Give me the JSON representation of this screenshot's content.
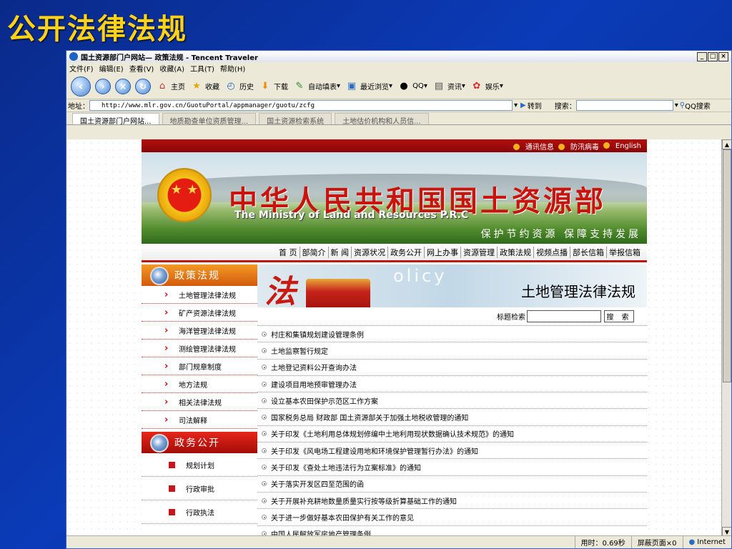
{
  "slide_title": "公开法律法规",
  "window": {
    "title": "国土资源部门户网站— 政策法规 - Tencent Traveler",
    "controls": [
      "_",
      "□",
      "×"
    ]
  },
  "menu": [
    "文件(F)",
    "编辑(E)",
    "查看(V)",
    "收藏(A)",
    "工具(T)",
    "帮助(H)"
  ],
  "toolbar": {
    "home": "主页",
    "favorites": "收藏",
    "history": "历史",
    "download": "下载",
    "autofill": "自动填表",
    "recent": "最近浏览",
    "qq": "QQ",
    "news": "资讯",
    "fun": "娱乐"
  },
  "address": {
    "label": "地址：",
    "url": "http://www.mlr.gov.cn/GuotuPortal/appmanager/guotu/zcfg",
    "go": "转到",
    "search_label": "搜索：",
    "qq_search": "QQ搜索"
  },
  "tabs": [
    "国土资源部门户网站...",
    "地质勘查单位资质管理...",
    "国土资源检索系统",
    "土地估价机构和人员信..."
  ],
  "site": {
    "top_links": [
      "通讯信息",
      "防汛病毒",
      "English"
    ],
    "title_cn": "中华人民共和国国土资源部",
    "title_en": "The Ministry of Land and Resources P.R.C",
    "slogan": "保护节约资源  保障支持发展",
    "nav": [
      "首 页",
      "部简介",
      "新 闻",
      "资源状况",
      "政务公开",
      "网上办事",
      "资源管理",
      "政策法规",
      "视频点播",
      "部长信箱",
      "举报信箱"
    ]
  },
  "left": {
    "section1": "政策法规",
    "section1_items": [
      "土地管理法律法规",
      "矿产资源法律法规",
      "海洋管理法律法规",
      "测绘管理法律法规",
      "部门规章制度",
      "地方法规",
      "相关法律法规",
      "司法解释"
    ],
    "section2": "政务公开",
    "section2_items": [
      "规划计划",
      "行政审批",
      "行政执法"
    ]
  },
  "right": {
    "hero_char": "法",
    "hero_word": "olicy",
    "heading": "土地管理法律法规",
    "search_label": "标题检索",
    "search_button": "搜 索",
    "items": [
      "村庄和集镇规划建设管理条例",
      "土地监察暂行规定",
      "土地登记资料公开查询办法",
      "建设项目用地预审管理办法",
      "设立基本农田保护示范区工作方案",
      "国家税务总局 财政部 国土资源部关于加强土地税收管理的通知",
      "关于印发《土地利用总体规划修编中土地利用现状数据确认技术规范》的通知",
      "关于印发《风电场工程建设用地和环境保护管理暂行办法》的通知",
      "关于印发《查处土地违法行为立案标准》的通知",
      "关于落实开发区四至范围的函",
      "关于开展补充耕地数量质量实行按等级折算基础工作的通知",
      "关于进一步做好基本农田保护有关工作的意见",
      "中国人民解放军房地产管理条例"
    ]
  },
  "status": {
    "time": "用时：0.69秒",
    "blocked": "屏蔽页面×0",
    "zone": "Internet"
  }
}
